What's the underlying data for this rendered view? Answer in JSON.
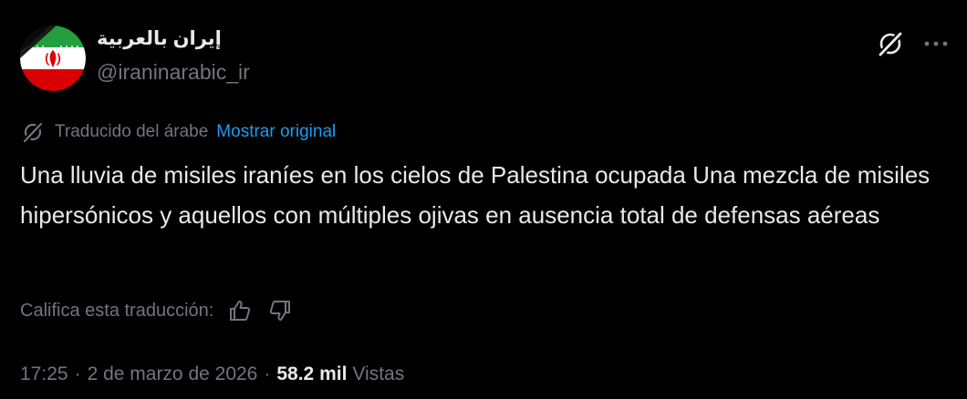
{
  "author": {
    "display_name": "إيران بالعربية",
    "handle": "@iraninarabic_ir"
  },
  "icons": {
    "avatar": "iran-flag-with-black-ribbon",
    "grok": "grok-icon",
    "more": "more-icon",
    "translate": "translate-icon",
    "thumbs_up": "thumbs-up-icon",
    "thumbs_down": "thumbs-down-icon"
  },
  "translation": {
    "translated_from": "Traducido del árabe",
    "show_original": "Mostrar original"
  },
  "tweet": {
    "text": "Una lluvia de misiles iraníes en los cielos de Palestina ocupada Una mezcla de misiles hipersónicos y aquellos con múltiples ojivas en ausencia total de defensas aéreas"
  },
  "rating": {
    "label": "Califica esta traducción:"
  },
  "meta": {
    "time": "17:25",
    "separator": "·",
    "date": "2 de marzo de 2026",
    "views_count": "58.2 mil",
    "views_label": "Vistas"
  },
  "colors": {
    "background": "#000000",
    "text_primary": "#e7e9ea",
    "text_secondary": "#71767b",
    "link": "#1d9bf0",
    "flag_green": "#239f40",
    "flag_red": "#da0000",
    "flag_white": "#ffffff"
  }
}
